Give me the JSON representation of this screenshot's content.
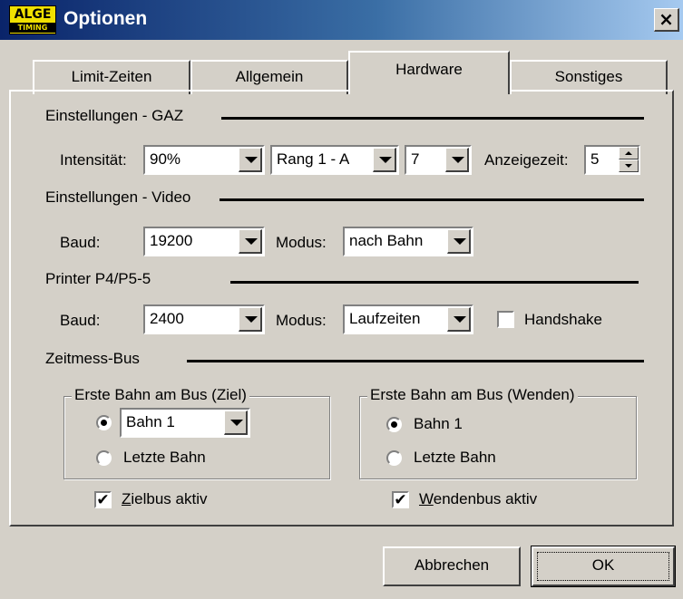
{
  "window": {
    "title": "Optionen",
    "logo_text": "ALGE",
    "logo_subtext": "TIMING",
    "close_label": "×"
  },
  "tabs": [
    {
      "label": "Limit-Zeiten",
      "active": false
    },
    {
      "label": "Allgemein",
      "active": false
    },
    {
      "label": "Hardware",
      "active": true
    },
    {
      "label": "Sonstiges",
      "active": false
    }
  ],
  "gaz": {
    "section_title": "Einstellungen - GAZ",
    "intensity_label": "Intensität:",
    "intensity_value": "90%",
    "rank_value": "Rang 1 - A",
    "digit_value": "7",
    "display_time_label": "Anzeigezeit:",
    "display_time_value": "5"
  },
  "video": {
    "section_title": "Einstellungen - Video",
    "baud_label": "Baud:",
    "baud_value": "19200",
    "mode_label": "Modus:",
    "mode_value": "nach Bahn"
  },
  "printer": {
    "section_title": "Printer P4/P5-5",
    "baud_label": "Baud:",
    "baud_value": "2400",
    "mode_label": "Modus:",
    "mode_value": "Laufzeiten",
    "handshake_label": "Handshake",
    "handshake_checked": false
  },
  "bus": {
    "section_title": "Zeitmess-Bus",
    "finish": {
      "title": "Erste Bahn am Bus (Ziel)",
      "lane_value": "Bahn 1",
      "last_lane_label": "Letzte Bahn",
      "active_prefix": "Z",
      "active_rest": "ielbus aktiv",
      "active_checked": true
    },
    "turn": {
      "title": "Erste Bahn am Bus (Wenden)",
      "lane_label": "Bahn 1",
      "last_lane_label": "Letzte Bahn",
      "active_prefix": "W",
      "active_rest": "endenbus aktiv",
      "active_checked": true
    }
  },
  "buttons": {
    "cancel_label": "Abbrechen",
    "ok_label": "OK"
  },
  "check_mark": "✔"
}
